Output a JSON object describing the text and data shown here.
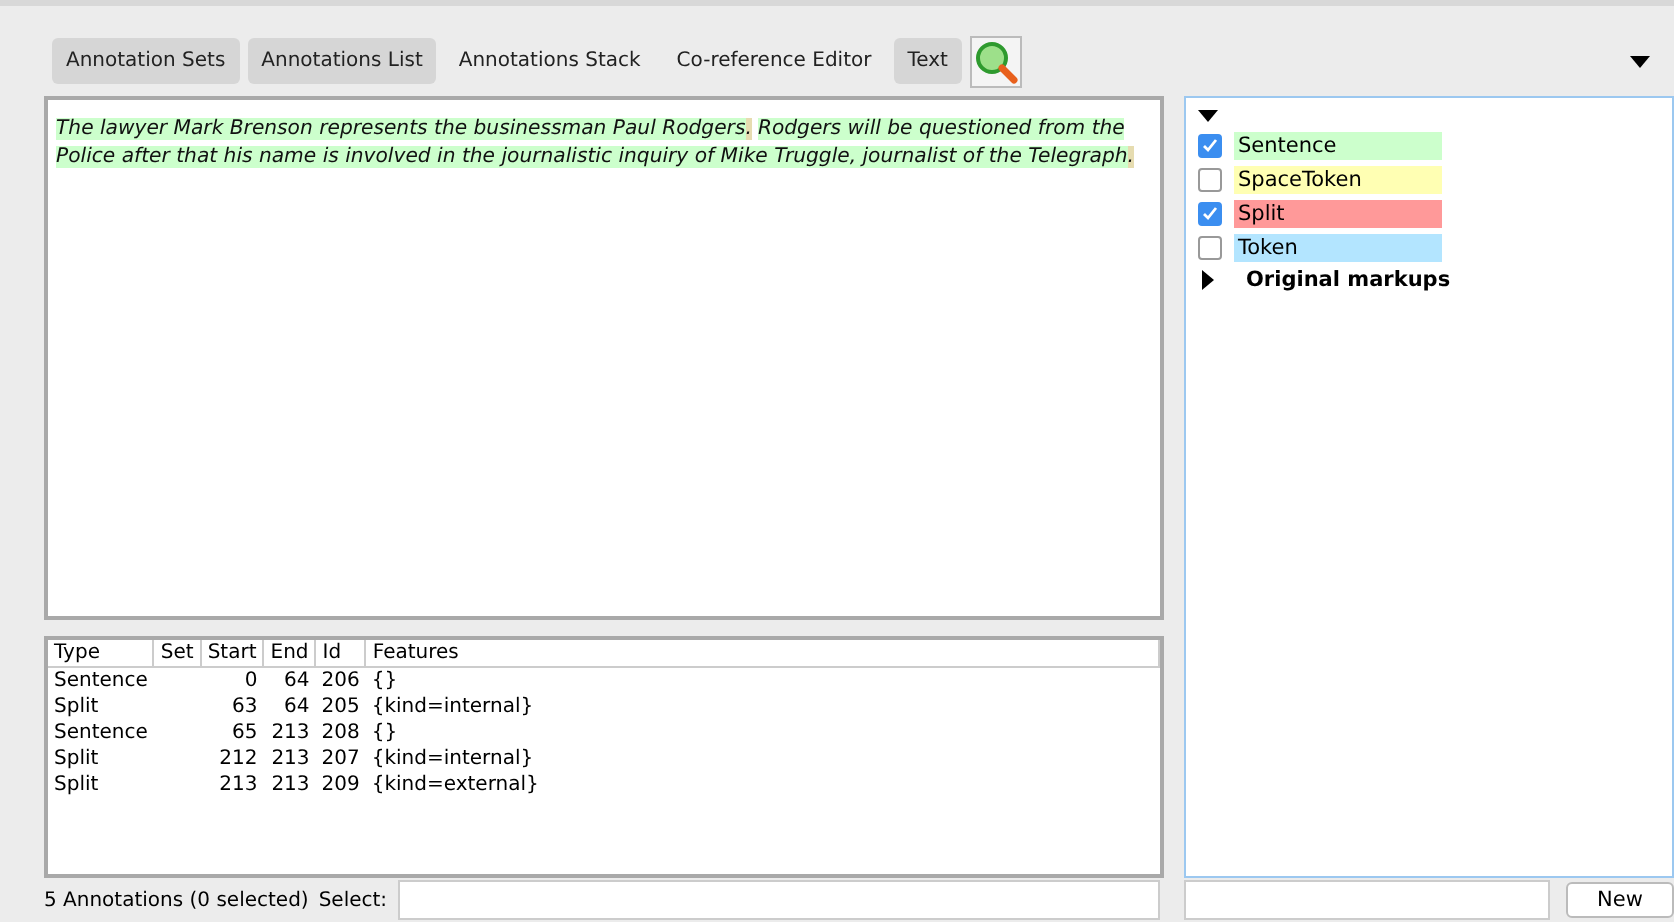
{
  "toolbar": {
    "buttons": [
      {
        "label": "Annotation Sets",
        "selected": true
      },
      {
        "label": "Annotations List",
        "selected": true
      },
      {
        "label": "Annotations Stack",
        "selected": false
      },
      {
        "label": "Co-reference Editor",
        "selected": false
      },
      {
        "label": "Text",
        "selected": true
      }
    ]
  },
  "document": {
    "segments": [
      {
        "text": "The lawyer Mark Brenson represents the businessman Paul Rodgers",
        "color": "#ccffcc"
      },
      {
        "text": ".",
        "color": "#e6dcb0"
      },
      {
        "text": "Rodgers will be questioned from the Police after that his name is involved in the journalistic inquiry of Mike Truggle, journalist of the Telegraph",
        "color": "#ccffcc",
        "space_before": true
      },
      {
        "text": ".",
        "color": "#e6dcb0"
      }
    ]
  },
  "table": {
    "columns": [
      "Type",
      "Set",
      "Start",
      "End",
      "Id",
      "Features"
    ],
    "rows": [
      [
        "Sentence",
        "",
        "0",
        "64",
        "206",
        "{}"
      ],
      [
        "Split",
        "",
        "63",
        "64",
        "205",
        "{kind=internal}"
      ],
      [
        "Sentence",
        "",
        "65",
        "213",
        "208",
        "{}"
      ],
      [
        "Split",
        "",
        "212",
        "213",
        "207",
        "{kind=internal}"
      ],
      [
        "Split",
        "",
        "213",
        "213",
        "209",
        "{kind=external}"
      ]
    ]
  },
  "status": {
    "text": "5 Annotations (0 selected)",
    "select_label": "Select:"
  },
  "sets": {
    "types": [
      {
        "name": "Sentence",
        "checked": true,
        "color": "#ccffcc"
      },
      {
        "name": "SpaceToken",
        "checked": false,
        "color": "#ffffb3"
      },
      {
        "name": "Split",
        "checked": true,
        "color": "#ff9999"
      },
      {
        "name": "Token",
        "checked": false,
        "color": "#b3e5ff"
      }
    ],
    "groups": [
      {
        "name": "Original markups",
        "expanded": false
      }
    ],
    "new_button": "New"
  }
}
